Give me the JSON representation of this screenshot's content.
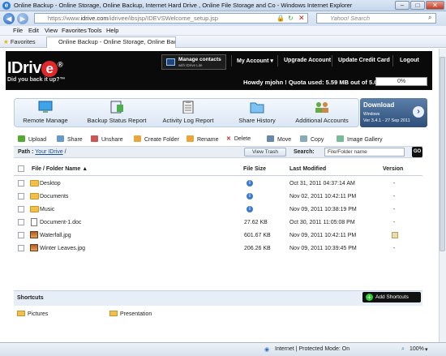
{
  "window": {
    "title": "Online Backup - Online Storage, Online Backup, Internet Hard Drive , Online File Storage and Co - Windows Internet Explorer"
  },
  "addressbar": {
    "url_prefix": "https://www.",
    "url_main": "idrive.com",
    "url_rest": "/idrivee/ibsjsp/IDEVSWelcome_setup.jsp",
    "search_placeholder": "Yahoo! Search"
  },
  "menu": [
    "File",
    "Edit",
    "View",
    "Favorites",
    "Tools",
    "Help"
  ],
  "favorites": {
    "label": "Favorites",
    "tab_title": "Online Backup - Online Storage, Online Backup, I..."
  },
  "site": {
    "logo_text": "IDriv",
    "logo_e": "e",
    "tagline": "Did you back it up?™",
    "manage_contacts": "Manage contacts",
    "manage_sub": "with IDrive Lite",
    "nav": [
      "My Account ▾",
      "Upgrade Account",
      "Update Credit Card",
      "Logout"
    ],
    "greeting": "Howdy mjohn ! Quota used: 5.59 MB out of 5.0 GB",
    "quota_pct": "0%"
  },
  "tabs": [
    {
      "label": "Remote Manage",
      "icon": "monitor-icon"
    },
    {
      "label": "Backup Status Report",
      "icon": "report-icon"
    },
    {
      "label": "Activity Log Report",
      "icon": "clipboard-icon"
    },
    {
      "label": "Share History",
      "icon": "share-folder-icon"
    },
    {
      "label": "Additional Accounts",
      "icon": "users-icon"
    }
  ],
  "download": {
    "title": "Download",
    "os": "Windows",
    "version": "Ver 3.4.1 - 27 Sep 2011"
  },
  "toolbar": [
    "Upload",
    "Share",
    "Unshare",
    "Create Folder",
    "Rename",
    "Delete",
    "Move",
    "Copy",
    "Image Gallery"
  ],
  "path": {
    "label": "Path :",
    "current": "Your IDrive",
    "sep": "/",
    "view_trash": "View Trash",
    "search_label": "Search:",
    "search_value": "File/Folder name",
    "go": "GO"
  },
  "table": {
    "headers": {
      "name": "File / Folder Name ▲",
      "size": "File Size",
      "modified": "Last Modified",
      "version": "Version"
    },
    "rows": [
      {
        "name": "Desktop",
        "type": "folder",
        "size": "",
        "modified": "Oct 31, 2011 04:37:14 AM",
        "version": "-"
      },
      {
        "name": "Documents",
        "type": "folder",
        "size": "",
        "modified": "Nov 02, 2011 10:42:11 PM",
        "version": "-"
      },
      {
        "name": "Music",
        "type": "folder",
        "size": "",
        "modified": "Nov 09, 2011 10:38:19 PM",
        "version": "-"
      },
      {
        "name": "Document-1.doc",
        "type": "doc",
        "size": "27.62 KB",
        "modified": "Oct 30, 2011 11:05:08 PM",
        "version": "-"
      },
      {
        "name": "Waterfall.jpg",
        "type": "image",
        "size": "601.67 KB",
        "modified": "Nov 09, 2011 10:42:11 PM",
        "version": "icon"
      },
      {
        "name": "Winter Leaves.jpg",
        "type": "image",
        "size": "206.26 KB",
        "modified": "Nov 09, 2011 10:39:45 PM",
        "version": "-"
      }
    ]
  },
  "shortcuts": {
    "title": "Shortcuts",
    "add": "Add Shortcuts",
    "items": [
      "Pictures",
      "Presentation"
    ]
  },
  "statusbar": {
    "zone": "Internet | Protected Mode: On",
    "zoom": "100%"
  }
}
